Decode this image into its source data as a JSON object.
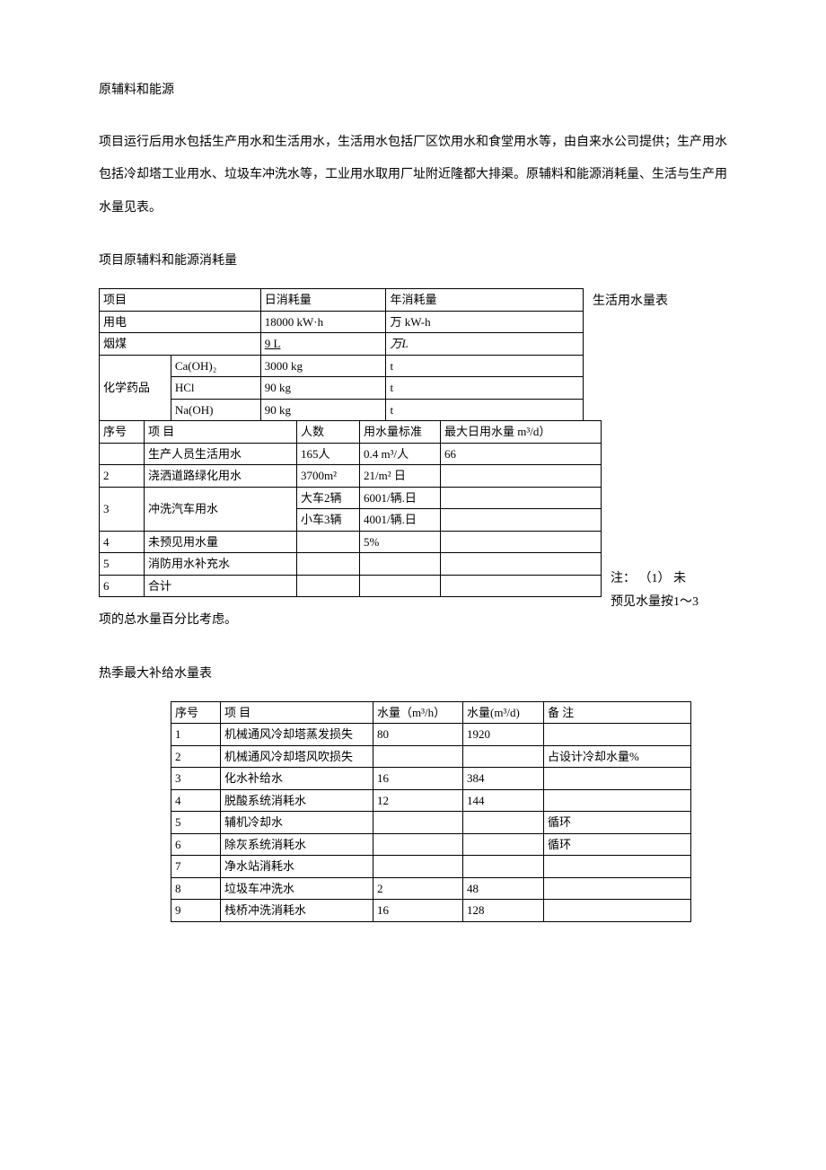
{
  "title": "原辅料和能源",
  "paragraph": "项目运行后用水包括生产用水和生活用水，生活用水包括厂区饮用水和食堂用水等，由自来水公司提供；生产用水包括冷却塔工业用水、垃圾车冲洗水等，工业用水取用厂址附近隆都大排渠。原辅料和能源消耗量、生活与生产用水量见表。",
  "sub1_title": "项目原辅料和能源消耗量",
  "table1": {
    "h_project": "项目",
    "h_daily": "日消耗量",
    "h_annual": "年消耗量",
    "r_power": "用电",
    "r_power_d": "18000 kW·h",
    "r_power_a": "万 kW-h",
    "r_coal": "烟煤",
    "r_coal_d": "9  L",
    "r_coal_a": "万L",
    "r_chem": "化学药品",
    "r_caoh": "Ca(OH)₂",
    "r_caoh_d": "3000 kg",
    "r_caoh_a": "t",
    "r_hcl": "HCl",
    "r_hcl_d": "90 kg",
    "r_hcl_a": "t",
    "r_naoh": "Na(OH)",
    "r_naoh_d": "90 kg",
    "r_naoh_a": "t"
  },
  "side1": "生活用水量表",
  "table2": {
    "h_no": "序号",
    "h_item": "项      目",
    "h_people": "人数",
    "h_std": "用水量标准",
    "h_max": "最大日用水量 m³/d）",
    "r1_item": "生产人员生活用水",
    "r1_people": "165人",
    "r1_std": "0.4 m³/人",
    "r1_max": "66",
    "r2_no": "2",
    "r2_item": "浇洒道路绿化用水",
    "r2_people": "3700m²",
    "r2_std": "21/m² 日",
    "r3_no": "3",
    "r3_item": "冲洗汽车用水",
    "r3a_people": "大车2辆",
    "r3a_std": "6001/辆.日",
    "r3b_people": "小车3辆",
    "r3b_std": "4001/辆.日",
    "r4_no": "4",
    "r4_item": "未预见用水量",
    "r4_std": "5%",
    "r5_no": "5",
    "r5_item": "消防用水补充水",
    "r6_no": "6",
    "r6_item": "合计"
  },
  "side2a": "注：      （1）   未",
  "side2b": "预见水量按1～3",
  "note_after": "项的总水量百分比考虑。",
  "sub3_title": "热季最大补给水量表",
  "table3": {
    "h_no": "序号",
    "h_item": "项          目",
    "h_flow": "水量（m³/h）",
    "h_day": "水量(m³/d)",
    "h_remark": "备           注",
    "r1_no": "1",
    "r1_item": "机械通风冷却塔蒸发损失",
    "r1_flow": "80",
    "r1_day": "1920",
    "r1_remark": "",
    "r2_no": "2",
    "r2_item": "机械通风冷却塔风吹损失",
    "r2_flow": "",
    "r2_day": "",
    "r2_remark": "占设计冷却水量%",
    "r3_no": "3",
    "r3_item": "化水补给水",
    "r3_flow": "16",
    "r3_day": "384",
    "r3_remark": "",
    "r4_no": "4",
    "r4_item": "脱酸系统消耗水",
    "r4_flow": "12",
    "r4_day": "144",
    "r4_remark": "",
    "r5_no": "5",
    "r5_item": "辅机冷却水",
    "r5_flow": "",
    "r5_day": "",
    "r5_remark": "循环",
    "r6_no": "6",
    "r6_item": "除灰系统消耗水",
    "r6_flow": "",
    "r6_day": "",
    "r6_remark": "循环",
    "r7_no": "7",
    "r7_item": "净水站消耗水",
    "r7_flow": "",
    "r7_day": "",
    "r7_remark": "",
    "r8_no": "8",
    "r8_item": "垃圾车冲洗水",
    "r8_flow": "2",
    "r8_day": "48",
    "r8_remark": "",
    "r9_no": "9",
    "r9_item": "栈桥冲洗消耗水",
    "r9_flow": "16",
    "r9_day": "128",
    "r9_remark": ""
  }
}
